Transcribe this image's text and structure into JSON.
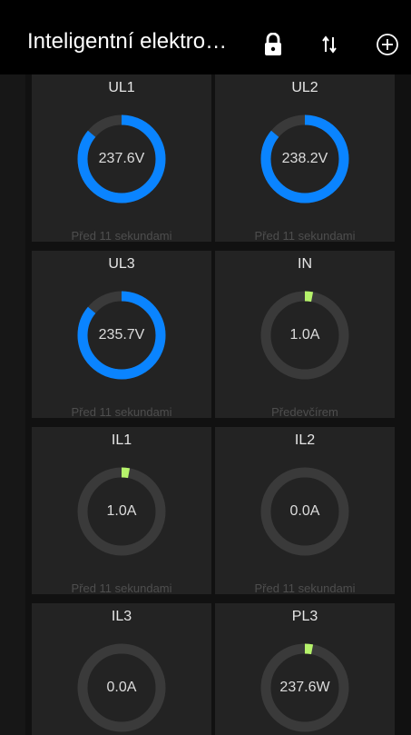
{
  "header": {
    "title": "Inteligentní elektro…",
    "icons": [
      "lock-icon",
      "sort-arrows-icon",
      "add-circle-icon"
    ]
  },
  "colors": {
    "gauge_track": "#3a3a3a",
    "voltage_accent": "#0a84ff",
    "current_accent": "#b6f36b",
    "tile_bg": "#232323",
    "header_bg": "#000000"
  },
  "tiles": [
    {
      "label": "UL1",
      "value": "237.6V",
      "fill": 0.86,
      "color": "#0a84ff",
      "time": "Před 11 sekundami"
    },
    {
      "label": "UL2",
      "value": "238.2V",
      "fill": 0.86,
      "color": "#0a84ff",
      "time": "Před 11 sekundami"
    },
    {
      "label": "UL3",
      "value": "235.7V",
      "fill": 0.86,
      "color": "#0a84ff",
      "time": "Před 11 sekundami"
    },
    {
      "label": "IN",
      "value": "1.0A",
      "fill": 0.03,
      "color": "#b6f36b",
      "time": "Předevčírem"
    },
    {
      "label": "IL1",
      "value": "1.0A",
      "fill": 0.03,
      "color": "#b6f36b",
      "time": "Před 11 sekundami"
    },
    {
      "label": "IL2",
      "value": "0.0A",
      "fill": 0,
      "color": "#b6f36b",
      "time": "Před 11 sekundami"
    },
    {
      "label": "IL3",
      "value": "0.0A",
      "fill": 0,
      "color": "#b6f36b",
      "time": ""
    },
    {
      "label": "PL3",
      "value": "237.6W",
      "fill": 0.03,
      "color": "#b6f36b",
      "time": ""
    }
  ]
}
